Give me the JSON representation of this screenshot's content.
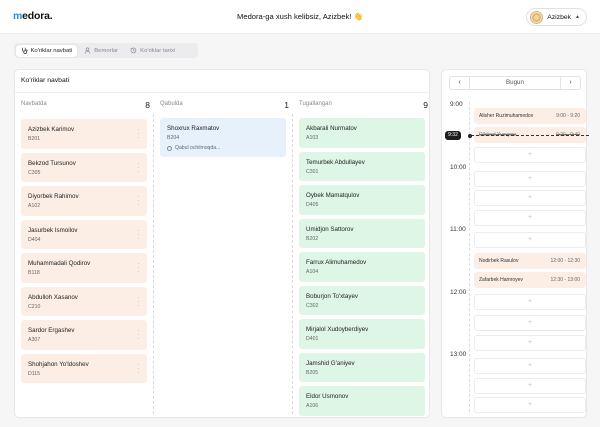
{
  "header": {
    "logo_accent": "m",
    "logo_rest": "edora.",
    "welcome": "Medora-ga xush kelibsiz, Azizbek! 👋",
    "user_name": "Azizbek"
  },
  "tabs": [
    {
      "label": "Ko'riklar navbati",
      "icon": "stethoscope-icon",
      "active": true
    },
    {
      "label": "Bemorlar",
      "icon": "user-icon",
      "active": false
    },
    {
      "label": "Ko'riklar tarixi",
      "icon": "history-icon",
      "active": false
    }
  ],
  "board": {
    "title": "Ko'riklar navbati",
    "columns": [
      {
        "name": "Navbatda",
        "count": "8",
        "status": "waiting",
        "cards": [
          {
            "name": "Azizbek Karimov",
            "room": "B201"
          },
          {
            "name": "Bekzod Tursunov",
            "room": "C305"
          },
          {
            "name": "Diyorbek Rahimov",
            "room": "A102"
          },
          {
            "name": "Jasurbek Ismoilov",
            "room": "D404"
          },
          {
            "name": "Muhammadali Qodirov",
            "room": "B118"
          },
          {
            "name": "Abdulloh Xasanov",
            "room": "C210"
          },
          {
            "name": "Sardor Ergashev",
            "room": "A307"
          },
          {
            "name": "Shohjahon Yo'ldoshev",
            "room": "D115"
          }
        ]
      },
      {
        "name": "Qabulda",
        "count": "1",
        "status": "in-progress",
        "cards": [
          {
            "name": "Shoxrux Raxmatov",
            "room": "B204",
            "status_text": "Qabul ochilmoqda..."
          }
        ]
      },
      {
        "name": "Tugallangan",
        "count": "9",
        "status": "done",
        "cards": [
          {
            "name": "Akbarali Nurmatov",
            "room": "A103"
          },
          {
            "name": "Temurbek Abdullayev",
            "room": "C301"
          },
          {
            "name": "Oybek Mamatqulov",
            "room": "D405"
          },
          {
            "name": "Umidjon Sattorov",
            "room": "B202"
          },
          {
            "name": "Farrux Alimuhamedov",
            "room": "A104"
          },
          {
            "name": "Boburjon To'xtayev",
            "room": "C302"
          },
          {
            "name": "Mirjalol Xudoyberdiyev",
            "room": "D401"
          },
          {
            "name": "Jamshid G'aniyev",
            "room": "B205"
          },
          {
            "name": "Eldor Usmonov",
            "room": "A106"
          }
        ]
      }
    ]
  },
  "schedule": {
    "nav_label": "Bugun",
    "prev": "‹",
    "next": "›",
    "hours": [
      "9:00",
      "10:00",
      "11:00",
      "12:00",
      "13:00"
    ],
    "current_time": "9:32",
    "add_symbol": "+",
    "appointments": [
      {
        "name": "Alisher Ruzimuhamedov",
        "time": "9:00 - 9:20"
      },
      {
        "name": "Dilshod Yusupov",
        "time": "9:20 - 9:40"
      },
      {
        "name": "Nodirbek Rasulov",
        "time": "12:00 - 12:30"
      },
      {
        "name": "Zafarbek Hamroyev",
        "time": "12:30 - 13:00"
      }
    ]
  },
  "colors": {
    "accent": "#1b8df0",
    "waiting": "#fdeee5",
    "in_progress": "#e7f1fc",
    "done": "#def6e6"
  }
}
